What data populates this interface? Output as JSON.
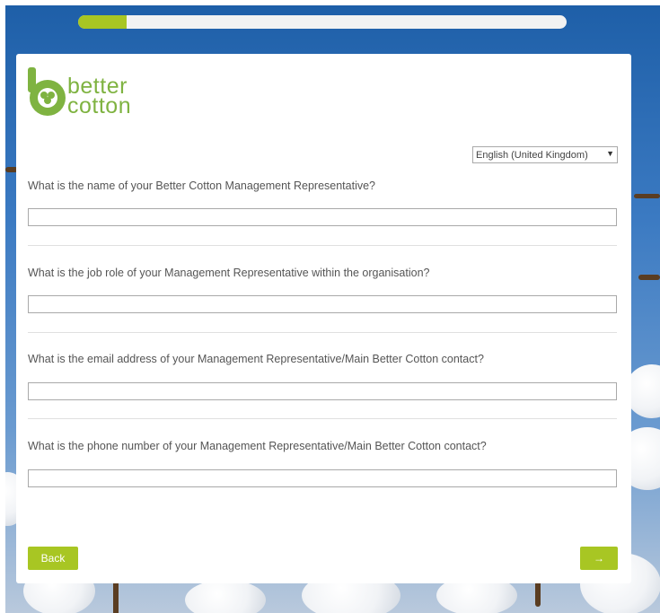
{
  "progress": {
    "fraction": 0.1
  },
  "logo": {
    "line1": "better",
    "line2": "cotton"
  },
  "language": {
    "selected": "English (United Kingdom)"
  },
  "questions": [
    {
      "label": "What is the name of your Better Cotton Management Representative?",
      "value": ""
    },
    {
      "label": "What is the job role of your Management Representative within the organisation?",
      "value": ""
    },
    {
      "label": "What is the email address of your Management Representative/Main Better Cotton contact?",
      "value": ""
    },
    {
      "label": "What is the phone number of your Management Representative/Main Better Cotton contact?",
      "value": ""
    }
  ],
  "buttons": {
    "back": "Back",
    "next": "→"
  },
  "colors": {
    "accent": "#a8c623",
    "brand_green": "#7fb341",
    "sky": "#3b7ac2"
  }
}
